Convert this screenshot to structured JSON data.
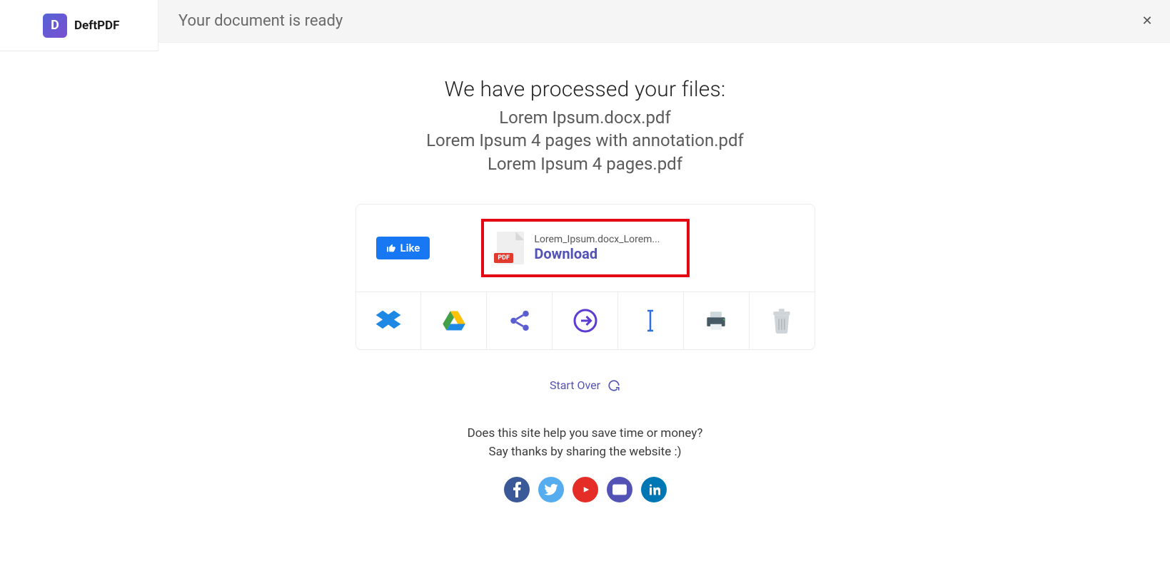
{
  "logo": {
    "badge": "D",
    "text": "DeftPDF"
  },
  "header": {
    "title": "Your document is ready"
  },
  "processed": {
    "heading": "We have processed your files:",
    "files": [
      "Lorem Ipsum.docx.pdf",
      "Lorem Ipsum 4 pages with annotation.pdf",
      "Lorem Ipsum 4 pages.pdf"
    ]
  },
  "like": {
    "label": "Like"
  },
  "download": {
    "filename": "Lorem_Ipsum.docx_Lorem...",
    "pdf_tag": "PDF",
    "label": "Download"
  },
  "startover": {
    "label": "Start Over"
  },
  "thanks": {
    "line1": "Does this site help you save time or money?",
    "line2": "Say thanks by sharing the website :)"
  }
}
